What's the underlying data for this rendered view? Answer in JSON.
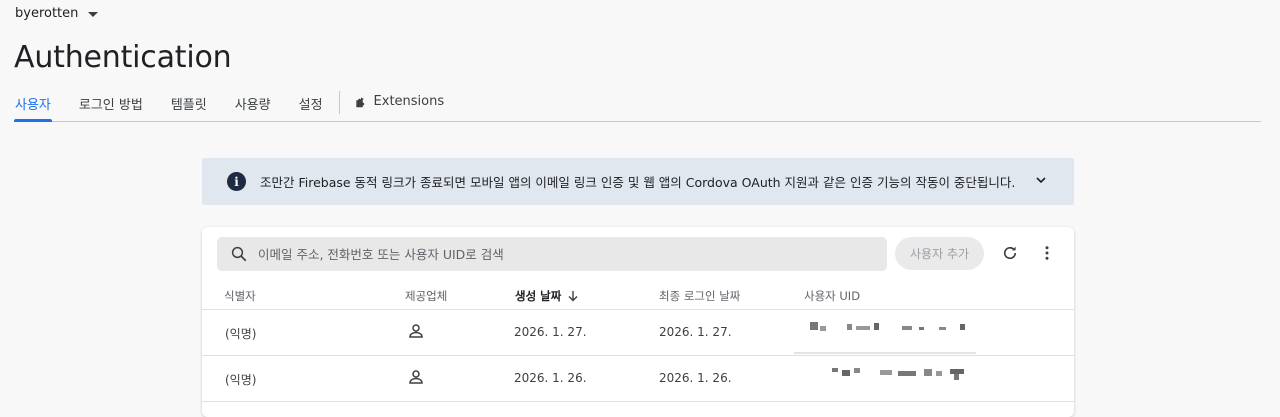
{
  "project": {
    "name": "byerotten"
  },
  "page": {
    "title": "Authentication"
  },
  "tabs": [
    {
      "label": "사용자",
      "active": true
    },
    {
      "label": "로그인 방법"
    },
    {
      "label": "템플릿"
    },
    {
      "label": "사용량"
    },
    {
      "label": "설정"
    }
  ],
  "extensions_tab": {
    "label": "Extensions",
    "icon": "extensions-icon"
  },
  "banner": {
    "icon": "info-icon",
    "text": "조만간 Firebase 동적 링크가 종료되면 모바일 앱의 이메일 링크 인증 및 웹 앱의 Cordova OAuth 지원과 같은 인증 기능의 작동이 중단됩니다.",
    "background": "#e1e7ef"
  },
  "search": {
    "placeholder": "이메일 주소, 전화번호 또는 사용자 UID로 검색"
  },
  "toolbar": {
    "add_user_label": "사용자 추가"
  },
  "table": {
    "columns": [
      "식별자",
      "제공업체",
      "생성 날짜",
      "최종 로그인 날짜",
      "사용자 UID"
    ],
    "sorted_column": "생성 날짜",
    "sort_direction": "descending",
    "rows": [
      {
        "identifier": "(익명)",
        "provider_icon": "person-icon",
        "created": "2026. 1. 27.",
        "last_sign_in": "2026. 1. 27.",
        "uid": ""
      },
      {
        "identifier": "(익명)",
        "provider_icon": "person-icon",
        "created": "2026. 1. 26.",
        "last_sign_in": "2026. 1. 26.",
        "uid": ""
      }
    ]
  },
  "colors": {
    "accent": "#1a73e8",
    "info_icon_bg": "#1f2a44"
  }
}
